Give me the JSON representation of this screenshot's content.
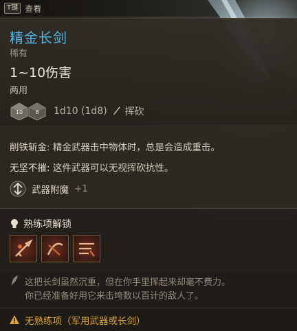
{
  "hint": {
    "key": "T键",
    "label": "查看"
  },
  "item": {
    "name": "精金长剑",
    "rarity": "稀有",
    "damage": "1~10伤害",
    "hands": "两用",
    "dice_roll": "1d10 (1d8)",
    "damage_type": "挥砍",
    "dice_faces": [
      "10",
      "8"
    ],
    "name_color": "#53b6e6"
  },
  "passives": [
    {
      "name": "削铁斩金:",
      "desc": " 精金武器击中物体时，总是会造成重击。"
    },
    {
      "name": "无坚不摧:",
      "desc": " 这件武器可以无视挥砍抗性。"
    }
  ],
  "enchant": {
    "label": "武器附魔",
    "value": "+1",
    "icon": "enchant-icon"
  },
  "proficiency": {
    "title": "熟练项解锁",
    "abilities": [
      "weapon-action-1-icon",
      "weapon-action-2-icon",
      "weapon-action-3-icon"
    ]
  },
  "flavor": {
    "line1": "这把长剑虽然沉重，但在你手里挥起来却毫不费力。",
    "line2": "你已经准备好用它来击垮数以百计的敌人了。"
  },
  "warning": {
    "text": "无熟练项（军用武器或长剑）",
    "color": "#e0a63b"
  }
}
